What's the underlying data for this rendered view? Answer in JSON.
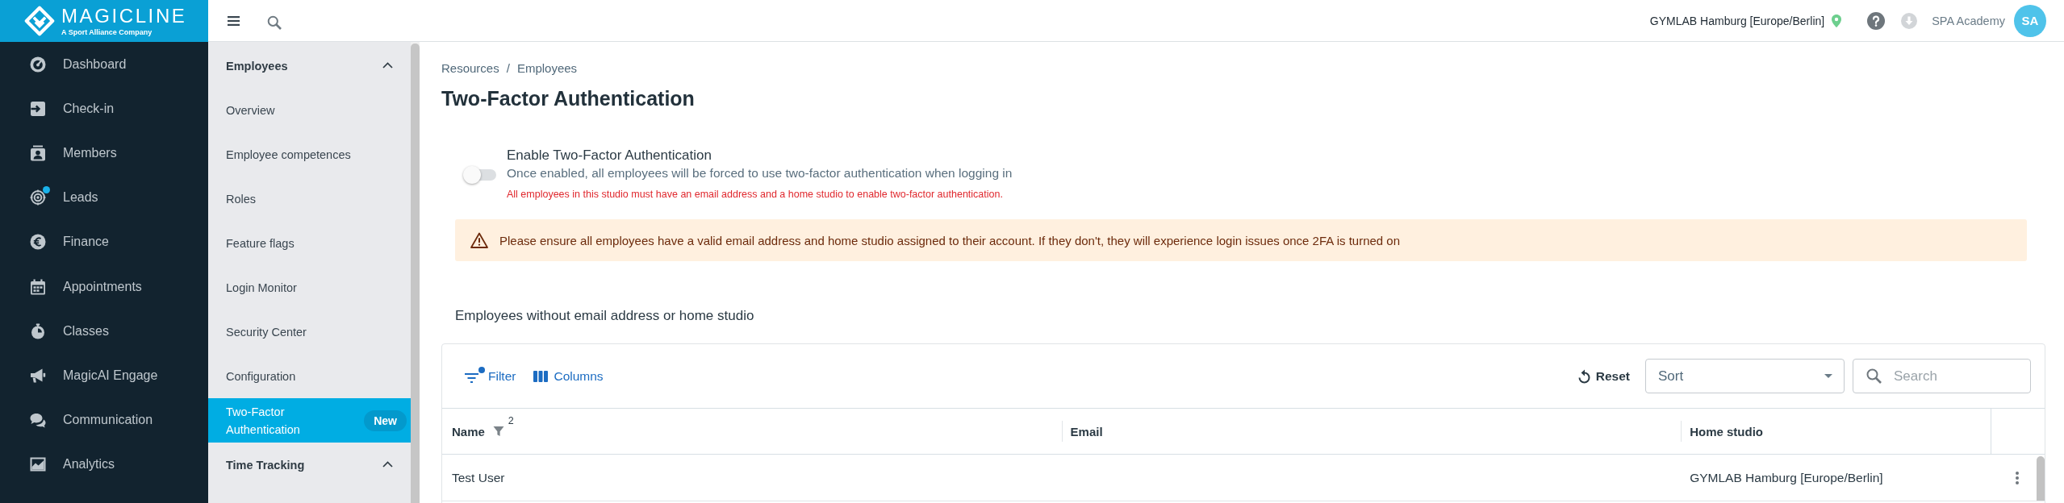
{
  "brand": {
    "name": "MAGICLINE",
    "tagline": "A Sport Alliance Company"
  },
  "nav": {
    "items": [
      {
        "label": "Dashboard",
        "selected": false,
        "notification": false
      },
      {
        "label": "Check-in",
        "selected": false,
        "notification": false
      },
      {
        "label": "Members",
        "selected": false,
        "notification": false
      },
      {
        "label": "Leads",
        "selected": false,
        "notification": true
      },
      {
        "label": "Finance",
        "selected": false,
        "notification": false
      },
      {
        "label": "Appointments",
        "selected": false,
        "notification": false
      },
      {
        "label": "Classes",
        "selected": false,
        "notification": false
      },
      {
        "label": "MagicAI Engage",
        "selected": false,
        "notification": false
      },
      {
        "label": "Communication",
        "selected": false,
        "notification": false
      },
      {
        "label": "Analytics",
        "selected": false,
        "notification": false
      }
    ]
  },
  "subnav": {
    "groups": [
      {
        "title": "Employees",
        "expanded": true,
        "items": [
          {
            "label": "Overview",
            "selected": false
          },
          {
            "label": "Employee competences",
            "selected": false
          },
          {
            "label": "Roles",
            "selected": false
          },
          {
            "label": "Feature flags",
            "selected": false
          },
          {
            "label": "Login Monitor",
            "selected": false
          },
          {
            "label": "Security Center",
            "selected": false
          },
          {
            "label": "Configuration",
            "selected": false
          },
          {
            "label": "Two-Factor Authentication",
            "selected": true,
            "badge": "New"
          }
        ]
      },
      {
        "title": "Time Tracking",
        "expanded": true
      }
    ]
  },
  "top_bar": {
    "studio": "GYMLAB Hamburg [Europe/Berlin]",
    "user_name": "SPA Academy",
    "avatar_initials": "SA"
  },
  "breadcrumb": {
    "items": [
      "Resources",
      "Employees"
    ],
    "separator": "/"
  },
  "page_title": "Two-Factor Authentication",
  "setting": {
    "label": "Enable Two-Factor Authentication",
    "description": "Once enabled, all employees will be forced to use two-factor authentication when logging in",
    "error": "All employees in this studio must have an email address and a home studio to enable two-factor authentication.",
    "on": false
  },
  "alert": {
    "kind": "warning",
    "text": "Please ensure all employees have a valid email address and home studio assigned to their account. If they don't, they will experience login issues once 2FA is turned on"
  },
  "section_title": "Employees without email address or home studio",
  "table": {
    "toolbar": {
      "filter": {
        "label": "Filter",
        "active": true
      },
      "columns_label": "Columns",
      "reset_label": "Reset",
      "sort": {
        "placeholder": "Sort"
      },
      "search": {
        "placeholder": "Search"
      }
    },
    "columns": [
      {
        "label": "Name",
        "filter_count": "2"
      },
      {
        "label": "Email"
      },
      {
        "label": "Home studio"
      }
    ],
    "rows": [
      {
        "cells": [
          "Test User",
          null,
          "GYMLAB Hamburg [Europe/Berlin]"
        ]
      }
    ]
  }
}
